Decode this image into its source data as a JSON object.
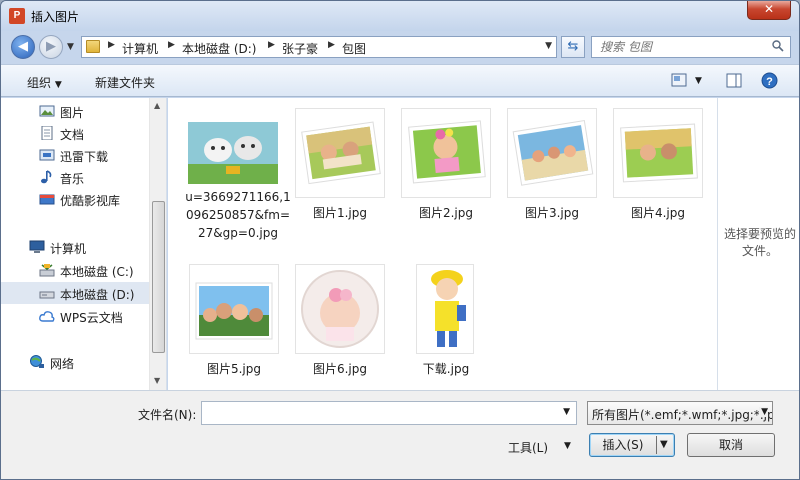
{
  "window": {
    "title": "插入图片",
    "app_icon": "powerpoint-icon",
    "close_glyph": "✕"
  },
  "nav": {
    "back_glyph": "◀",
    "forward_glyph": "▶",
    "breadcrumb": [
      "计算机",
      "本地磁盘 (D:)",
      "张子豪",
      "包图"
    ],
    "refresh_glyph": "⇆"
  },
  "search": {
    "placeholder": "搜索 包图",
    "value": ""
  },
  "toolbar": {
    "organize_label": "组织",
    "new_folder_label": "新建文件夹"
  },
  "sidebar": {
    "items": [
      {
        "label": "图片",
        "icon": "pictures-icon"
      },
      {
        "label": "文档",
        "icon": "documents-icon"
      },
      {
        "label": "迅雷下载",
        "icon": "thunder-download-icon"
      },
      {
        "label": "音乐",
        "icon": "music-icon"
      },
      {
        "label": "优酷影视库",
        "icon": "youku-library-icon"
      },
      {
        "label": "计算机",
        "icon": "computer-icon"
      },
      {
        "label": "本地磁盘 (C:)",
        "icon": "drive-c-icon"
      },
      {
        "label": "本地磁盘 (D:)",
        "icon": "drive-d-icon",
        "selected": true
      },
      {
        "label": "WPS云文档",
        "icon": "wps-cloud-icon"
      },
      {
        "label": "网络",
        "icon": "network-icon"
      }
    ]
  },
  "files": [
    {
      "name": "u=3669271166,1096250857&fm=27&gp=0.jpg",
      "thumb": "cartoon-goats"
    },
    {
      "name": "图片1.jpg",
      "thumb": "kids-photo"
    },
    {
      "name": "图片2.jpg",
      "thumb": "girl-photo"
    },
    {
      "name": "图片3.jpg",
      "thumb": "beach-photo"
    },
    {
      "name": "图片4.jpg",
      "thumb": "kids-grass-photo"
    },
    {
      "name": "图片5.jpg",
      "thumb": "group-photo"
    },
    {
      "name": "图片6.jpg",
      "thumb": "baby-circle"
    },
    {
      "name": "下载.jpg",
      "thumb": "cartoon-kid"
    }
  ],
  "preview": {
    "empty_text": "选择要预览的文件。"
  },
  "bottom": {
    "filename_label": "文件名(N):",
    "filename_value": "",
    "filter_value": "所有图片(*.emf;*.wmf;*.jpg;*.jp",
    "tools_label": "工具(L)",
    "insert_label": "插入(S)",
    "cancel_label": "取消"
  },
  "colors": {
    "title_bg": "#c4d5ec",
    "close_red": "#c8462f",
    "selection": "#dfe7f2"
  }
}
